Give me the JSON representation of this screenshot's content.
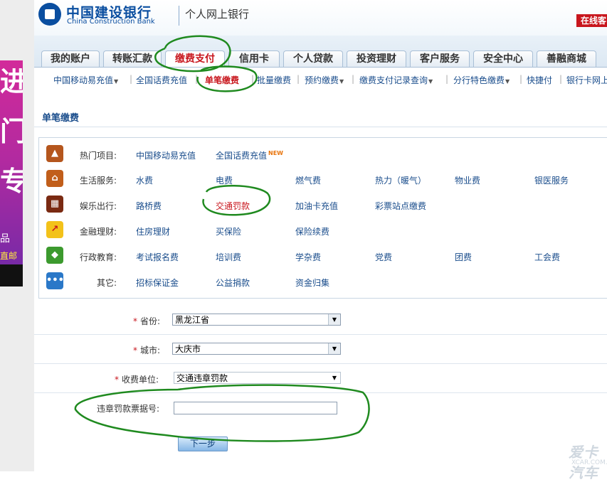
{
  "ad": {
    "line1": "进",
    "line2": "门",
    "line3": "专",
    "line4": "品",
    "line5": "直邮"
  },
  "header": {
    "bank_name_cn": "中国建设银行",
    "bank_name_en": "China Construction Bank",
    "portal_name": "个人网上银行",
    "online_service": "在线客"
  },
  "tabs": [
    {
      "label": "我的账户"
    },
    {
      "label": "转账汇款"
    },
    {
      "label": "缴费支付",
      "active": true
    },
    {
      "label": "信用卡"
    },
    {
      "label": "个人贷款"
    },
    {
      "label": "投资理财"
    },
    {
      "label": "客户服务"
    },
    {
      "label": "安全中心"
    },
    {
      "label": "善融商城"
    }
  ],
  "subnav": [
    {
      "label": "中国移动易充值",
      "dropdown": true
    },
    {
      "label": "全国话费充值"
    },
    {
      "label": "单笔缴费",
      "active": true
    },
    {
      "label": "批量缴费"
    },
    {
      "label": "预约缴费",
      "dropdown": true
    },
    {
      "label": "缴费支付记录查询",
      "dropdown": true
    },
    {
      "label": "分行特色缴费",
      "dropdown": true
    },
    {
      "label": "快捷付"
    },
    {
      "label": "银行卡网上"
    }
  ],
  "section_title": "单笔缴费",
  "categories": [
    {
      "label": "热门项目:",
      "icon": "hot-icon",
      "items": [
        "中国移动易充值",
        "全国话费充值"
      ],
      "new_badge": "NEW"
    },
    {
      "label": "生活服务:",
      "icon": "house-icon",
      "items": [
        "水费",
        "电费",
        "燃气费",
        "热力（暖气）",
        "物业费",
        "银医服务"
      ]
    },
    {
      "label": "娱乐出行:",
      "icon": "film-icon",
      "items": [
        "路桥费",
        "交通罚款",
        "加油卡充值",
        "彩票站点缴费"
      ]
    },
    {
      "label": "金融理财:",
      "icon": "chart-arrow-icon",
      "items": [
        "住房理财",
        "买保险",
        "保险续费"
      ]
    },
    {
      "label": "行政教育:",
      "icon": "graduation-cap-icon",
      "items": [
        "考试报名费",
        "培训费",
        "学杂费",
        "党费",
        "团费",
        "工会费"
      ]
    },
    {
      "label": "其它:",
      "icon": "more-dots-icon",
      "items": [
        "招标保证金",
        "公益捐款",
        "资金归集"
      ]
    }
  ],
  "form": {
    "province_label": "省份:",
    "province_value": "黑龙江省",
    "city_label": "城市:",
    "city_value": "大庆市",
    "unit_label": "收费单位:",
    "unit_value": "交通违章罚款",
    "ticket_label": "违章罚款票据号:",
    "ticket_value": "",
    "required_mark": "*",
    "next_button": "下一步"
  },
  "watermark": {
    "brand": "爱卡汽车",
    "domain": "XCAR.COM.CN"
  },
  "colors": {
    "brand_blue": "#0a4ea0",
    "accent_red": "#c8161d",
    "link_blue": "#1a4d8c",
    "annotation_green": "#1f8a1f"
  }
}
